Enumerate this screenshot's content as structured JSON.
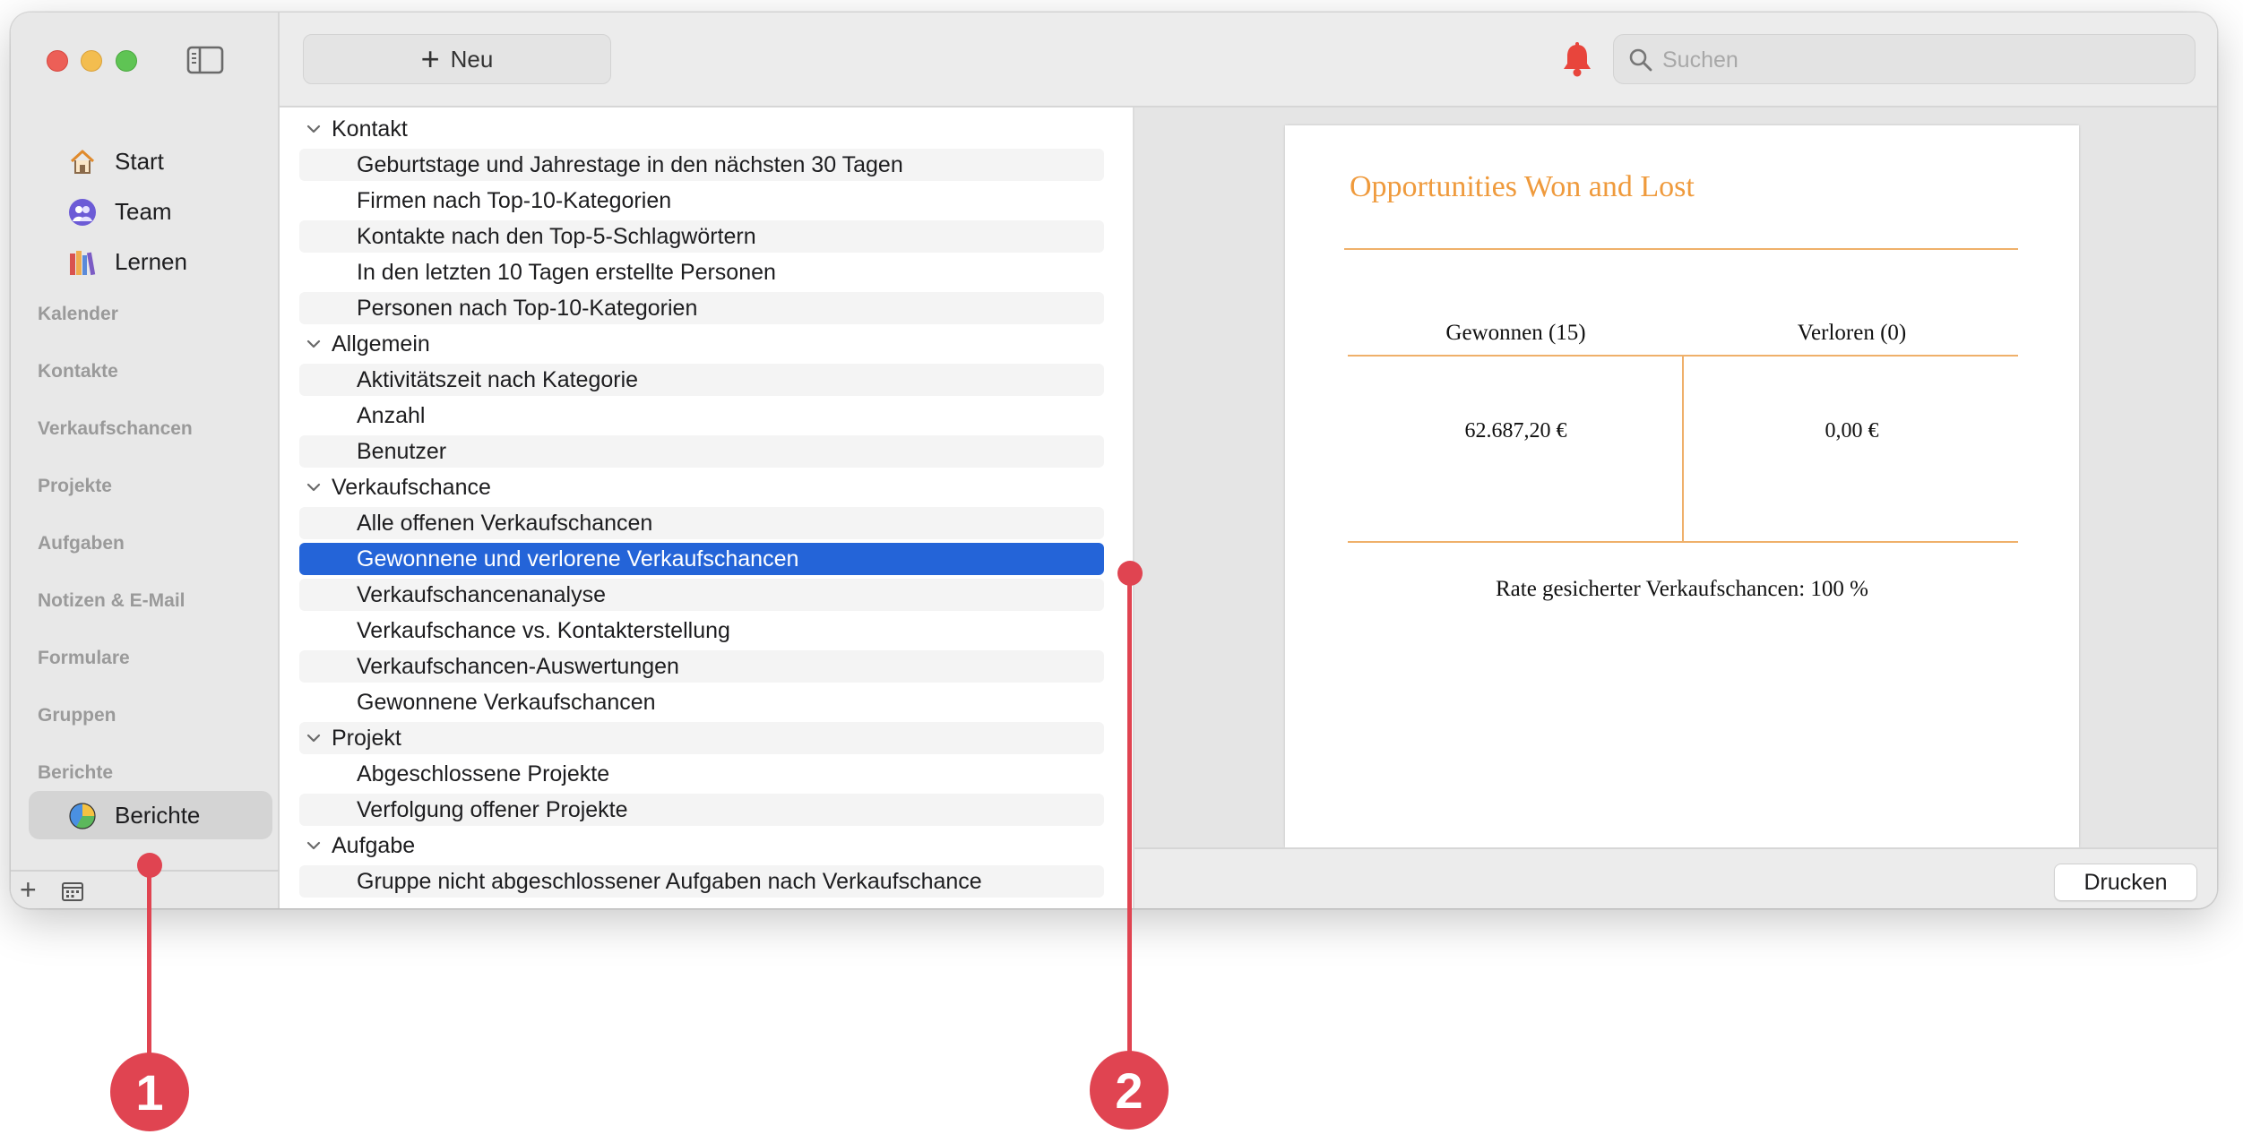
{
  "sidebar": {
    "nav": [
      {
        "label": "Start",
        "icon": "home-icon"
      },
      {
        "label": "Team",
        "icon": "team-icon"
      },
      {
        "label": "Lernen",
        "icon": "books-icon"
      }
    ],
    "sections": [
      "Kalender",
      "Kontakte",
      "Verkaufschancen",
      "Projekte",
      "Aufgaben",
      "Notizen & E-Mail",
      "Formulare",
      "Gruppen",
      "Berichte"
    ],
    "active_item": {
      "label": "Berichte",
      "icon": "pie-chart-icon"
    },
    "add_symbol": "+"
  },
  "toolbar": {
    "new_label": "Neu",
    "plus_symbol": "+",
    "search_placeholder": "Suchen"
  },
  "reports": {
    "rows": [
      {
        "text": "Kontakt",
        "group": true
      },
      {
        "text": "Geburtstage und Jahrestage in den nächsten 30 Tagen"
      },
      {
        "text": "Firmen nach Top-10-Kategorien"
      },
      {
        "text": "Kontakte nach den Top-5-Schlagwörtern"
      },
      {
        "text": "In den letzten 10 Tagen erstellte Personen"
      },
      {
        "text": "Personen nach Top-10-Kategorien"
      },
      {
        "text": "Allgemein",
        "group": true
      },
      {
        "text": "Aktivitätszeit nach Kategorie"
      },
      {
        "text": "Anzahl"
      },
      {
        "text": "Benutzer"
      },
      {
        "text": "Verkaufschance",
        "group": true
      },
      {
        "text": "Alle offenen Verkaufschancen"
      },
      {
        "text": "Gewonnene und verlorene Verkaufschancen",
        "selected": true
      },
      {
        "text": "Verkaufschancenanalyse"
      },
      {
        "text": "Verkaufschance vs. Kontakterstellung"
      },
      {
        "text": "Verkaufschancen-Auswertungen"
      },
      {
        "text": "Gewonnene Verkaufschancen"
      },
      {
        "text": "Projekt",
        "group": true
      },
      {
        "text": "Abgeschlossene Projekte"
      },
      {
        "text": "Verfolgung offener Projekte"
      },
      {
        "text": "Aufgabe",
        "group": true
      },
      {
        "text": "Gruppe nicht abgeschlossener Aufgaben nach Verkaufschance"
      }
    ]
  },
  "preview": {
    "title": "Opportunities Won and Lost",
    "won_header": "Gewonnen (15)",
    "lost_header": "Verloren (0)",
    "won_value": "62.687,20 €",
    "lost_value": "0,00 €",
    "rate": "Rate gesicherter Verkaufschancen: 100 %",
    "print_label": "Drucken"
  },
  "callouts": [
    {
      "number": "1"
    },
    {
      "number": "2"
    }
  ],
  "colors": {
    "selection": "#2464d8",
    "accent_orange": "#ef9a3c",
    "callout_red": "#e04451",
    "bell_red": "#e8453c"
  }
}
